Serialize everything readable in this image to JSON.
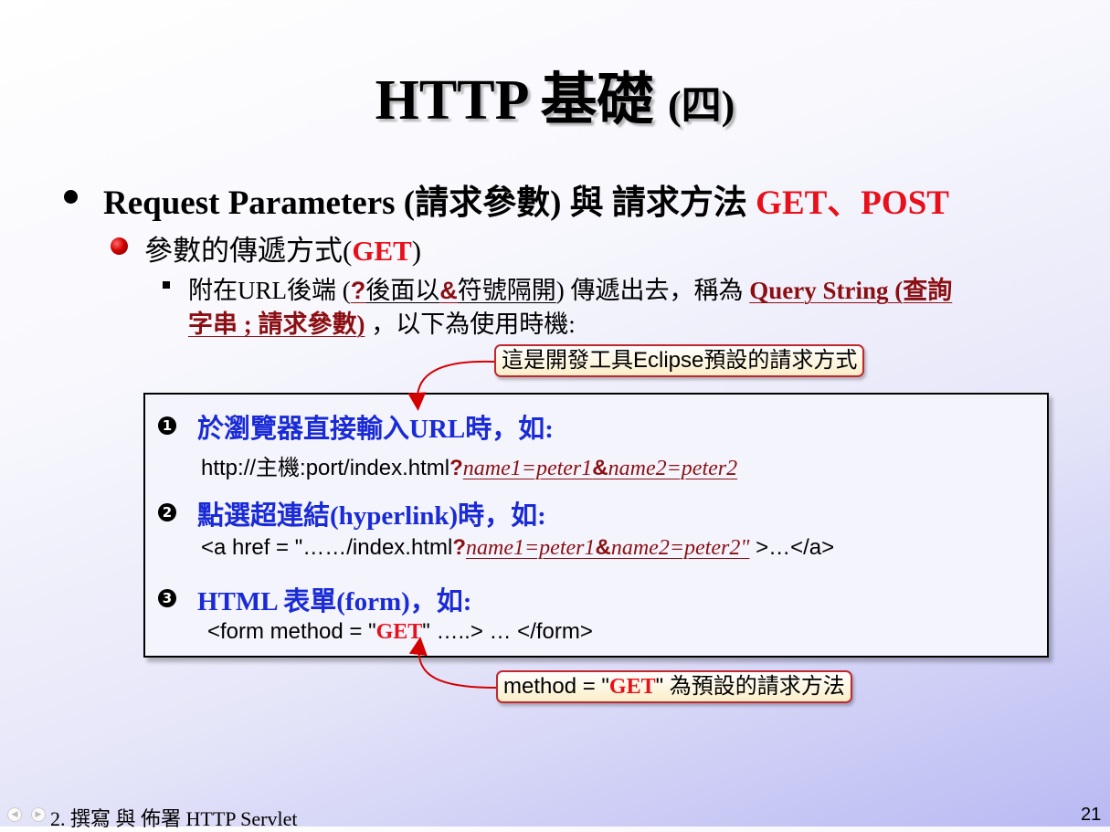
{
  "title": {
    "main": "HTTP 基礎",
    "sub": "(四)"
  },
  "bullet1": {
    "part1": "Request Parameters (",
    "part2": "請求參數",
    "part3": ") 與 請求方法 ",
    "methods": "GET、POST"
  },
  "bullet2": {
    "label": "參數的傳遞方式(",
    "get": "GET",
    "close": ")"
  },
  "bullet3": {
    "t1": "附在URL後端 (",
    "q": "?",
    "t2": "後面以",
    "amp": "&",
    "t3": "符號隔開",
    "t4": ") 傳遞出去，稱為 ",
    "qs1": "Query String (查詢",
    "qs2": "字串 ; 請求參數)",
    "t5": " ，以下為使用時機:"
  },
  "callout_top": "這是開發工具Eclipse預設的請求方式",
  "callout_bottom": {
    "prefix": "method = \"",
    "get": "GET",
    "suffix": "\" 為預設的請求方法"
  },
  "items": [
    {
      "num": "1",
      "title": "於瀏覽器直接輸入URL時，如:",
      "code_prefix": "http://主機:port/index.html",
      "q": "?",
      "p1": "name1=peter1",
      "amp": "&",
      "p2": "name2=peter2",
      "code_suffix": ""
    },
    {
      "num": "2",
      "title": "點選超連結(hyperlink)時，如:",
      "code_prefix": "<a href = \"……/index.html",
      "q": "?",
      "p1": "name1=peter1",
      "amp": "&",
      "p2": "name2=peter2\"",
      "code_suffix": " >…</a>"
    },
    {
      "num": "3",
      "title": "HTML 表單(form)，如:",
      "code_prefix": "<form method = \"",
      "get": "GET",
      "code_suffix": "\" …..> … </form>"
    }
  ],
  "footer": "2. 撰寫 與 佈署 HTTP Servlet",
  "page_number": "21",
  "colors": {
    "accent_red": "#e8101a",
    "dark_red": "#8b0f12",
    "item_blue": "#1a2bd6"
  }
}
